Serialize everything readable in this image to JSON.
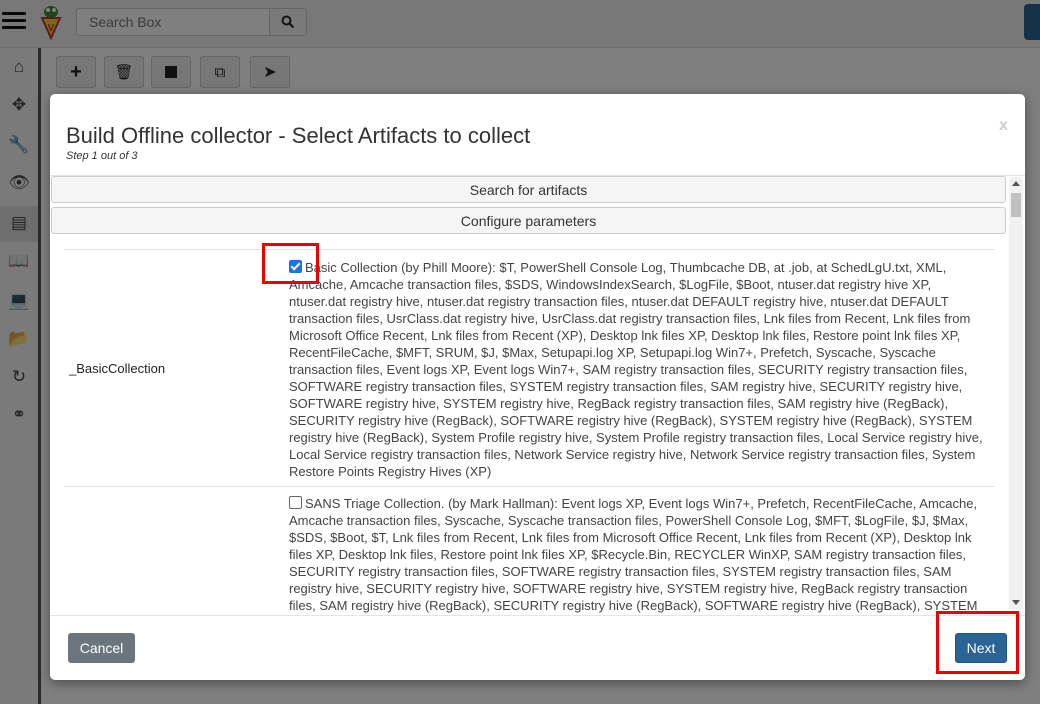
{
  "app": {
    "search": {
      "placeholder": "Search Box"
    },
    "toolbar": [
      "plus-icon",
      "trash-icon",
      "stop-icon",
      "copy-icon",
      "send-icon"
    ],
    "sidebar_icons": [
      "home-icon",
      "crosshair-icon",
      "wrench-icon",
      "eye-icon",
      "server-icon",
      "book-icon",
      "laptop-icon",
      "folder-icon",
      "history-icon",
      "binoculars-icon"
    ]
  },
  "modal": {
    "title": "Build Offline collector - Select Artifacts to collect",
    "subtitle": "Step 1 out of 3",
    "close_label": "x",
    "sections": {
      "search": "Search for artifacts",
      "configure": "Configure parameters"
    },
    "artifacts": [
      {
        "name": "_BasicCollection",
        "checked": true,
        "description": "Basic Collection (by Phill Moore): $T, PowerShell Console Log, Thumbcache DB, at .job, at SchedLgU.txt, XML, Amcache, Amcache transaction files, $SDS, WindowsIndexSearch, $LogFile, $Boot, ntuser.dat registry hive XP, ntuser.dat registry hive, ntuser.dat registry transaction files, ntuser.dat DEFAULT registry hive, ntuser.dat DEFAULT transaction files, UsrClass.dat registry hive, UsrClass.dat registry transaction files, Lnk files from Recent, Lnk files from Microsoft Office Recent, Lnk files from Recent (XP), Desktop lnk files XP, Desktop lnk files, Restore point lnk files XP, RecentFileCache, $MFT, SRUM, $J, $Max, Setupapi.log XP, Setupapi.log Win7+, Prefetch, Syscache, Syscache transaction files, Event logs XP, Event logs Win7+, SAM registry transaction files, SECURITY registry transaction files, SOFTWARE registry transaction files, SYSTEM registry transaction files, SAM registry hive, SECURITY registry hive, SOFTWARE registry hive, SYSTEM registry hive, RegBack registry transaction files, SAM registry hive (RegBack), SECURITY registry hive (RegBack), SOFTWARE registry hive (RegBack), SYSTEM registry hive (RegBack), SYSTEM registry hive (RegBack), System Profile registry hive, System Profile registry transaction files, Local Service registry hive, Local Service registry transaction files, Network Service registry hive, Network Service registry transaction files, System Restore Points Registry Hives (XP)"
      },
      {
        "name": "",
        "checked": false,
        "description": "SANS Triage Collection. (by Mark Hallman): Event logs XP, Event logs Win7+, Prefetch, RecentFileCache, Amcache, Amcache transaction files, Syscache, Syscache transaction files, PowerShell Console Log, $MFT, $LogFile, $J, $Max, $SDS, $Boot, $T, Lnk files from Recent, Lnk files from Microsoft Office Recent, Lnk files from Recent (XP), Desktop lnk files XP, Desktop lnk files, Restore point lnk files XP, $Recycle.Bin, RECYCLER WinXP, SAM registry transaction files, SECURITY registry transaction files, SOFTWARE registry transaction files, SYSTEM registry transaction files, SAM registry hive, SECURITY registry hive, SOFTWARE registry hive, SYSTEM registry hive, RegBack registry transaction files, SAM registry hive (RegBack), SECURITY registry hive (RegBack), SOFTWARE registry hive (RegBack), SYSTEM"
      }
    ],
    "buttons": {
      "cancel": "Cancel",
      "next": "Next"
    }
  }
}
